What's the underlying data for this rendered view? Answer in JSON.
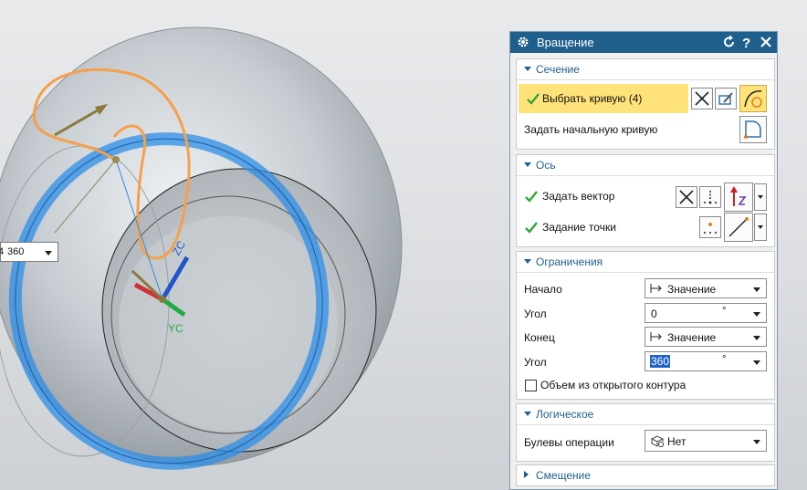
{
  "viewport": {
    "angle_input": {
      "value": "360",
      "edge_char": "4"
    },
    "axis_label_zc": "ZC",
    "axis_label_yc": "YC"
  },
  "dialog": {
    "title": "Вращение",
    "sections": {
      "section_curve": {
        "title": "Сечение",
        "select_curve_label": "Выбрать кривую (4)",
        "start_curve_label": "Задать начальную кривую"
      },
      "axis": {
        "title": "Ось",
        "vector_label": "Задать вектор",
        "point_label": "Задание точки"
      },
      "limits": {
        "title": "Ограничения",
        "start_label": "Начало",
        "start_mode": "Значение",
        "angle1_label": "Угол",
        "angle1_value": "0",
        "angle1_unit": "°",
        "end_label": "Конец",
        "end_mode": "Значение",
        "angle2_label": "Угол",
        "angle2_value": "360",
        "angle2_unit": "°",
        "open_profile_label": "Объем из открытого контура"
      },
      "boolean": {
        "title": "Логическое",
        "operation_label": "Булевы операции",
        "operation_value": "Нет"
      },
      "offset": {
        "title": "Смещение"
      }
    }
  },
  "colors": {
    "title_bar": "#1f5f8c",
    "section_title": "#1f5f8c",
    "highlight": "#ffe27a",
    "selection_blue": "#2e8de6",
    "curve_orange": "#f5a04a"
  }
}
